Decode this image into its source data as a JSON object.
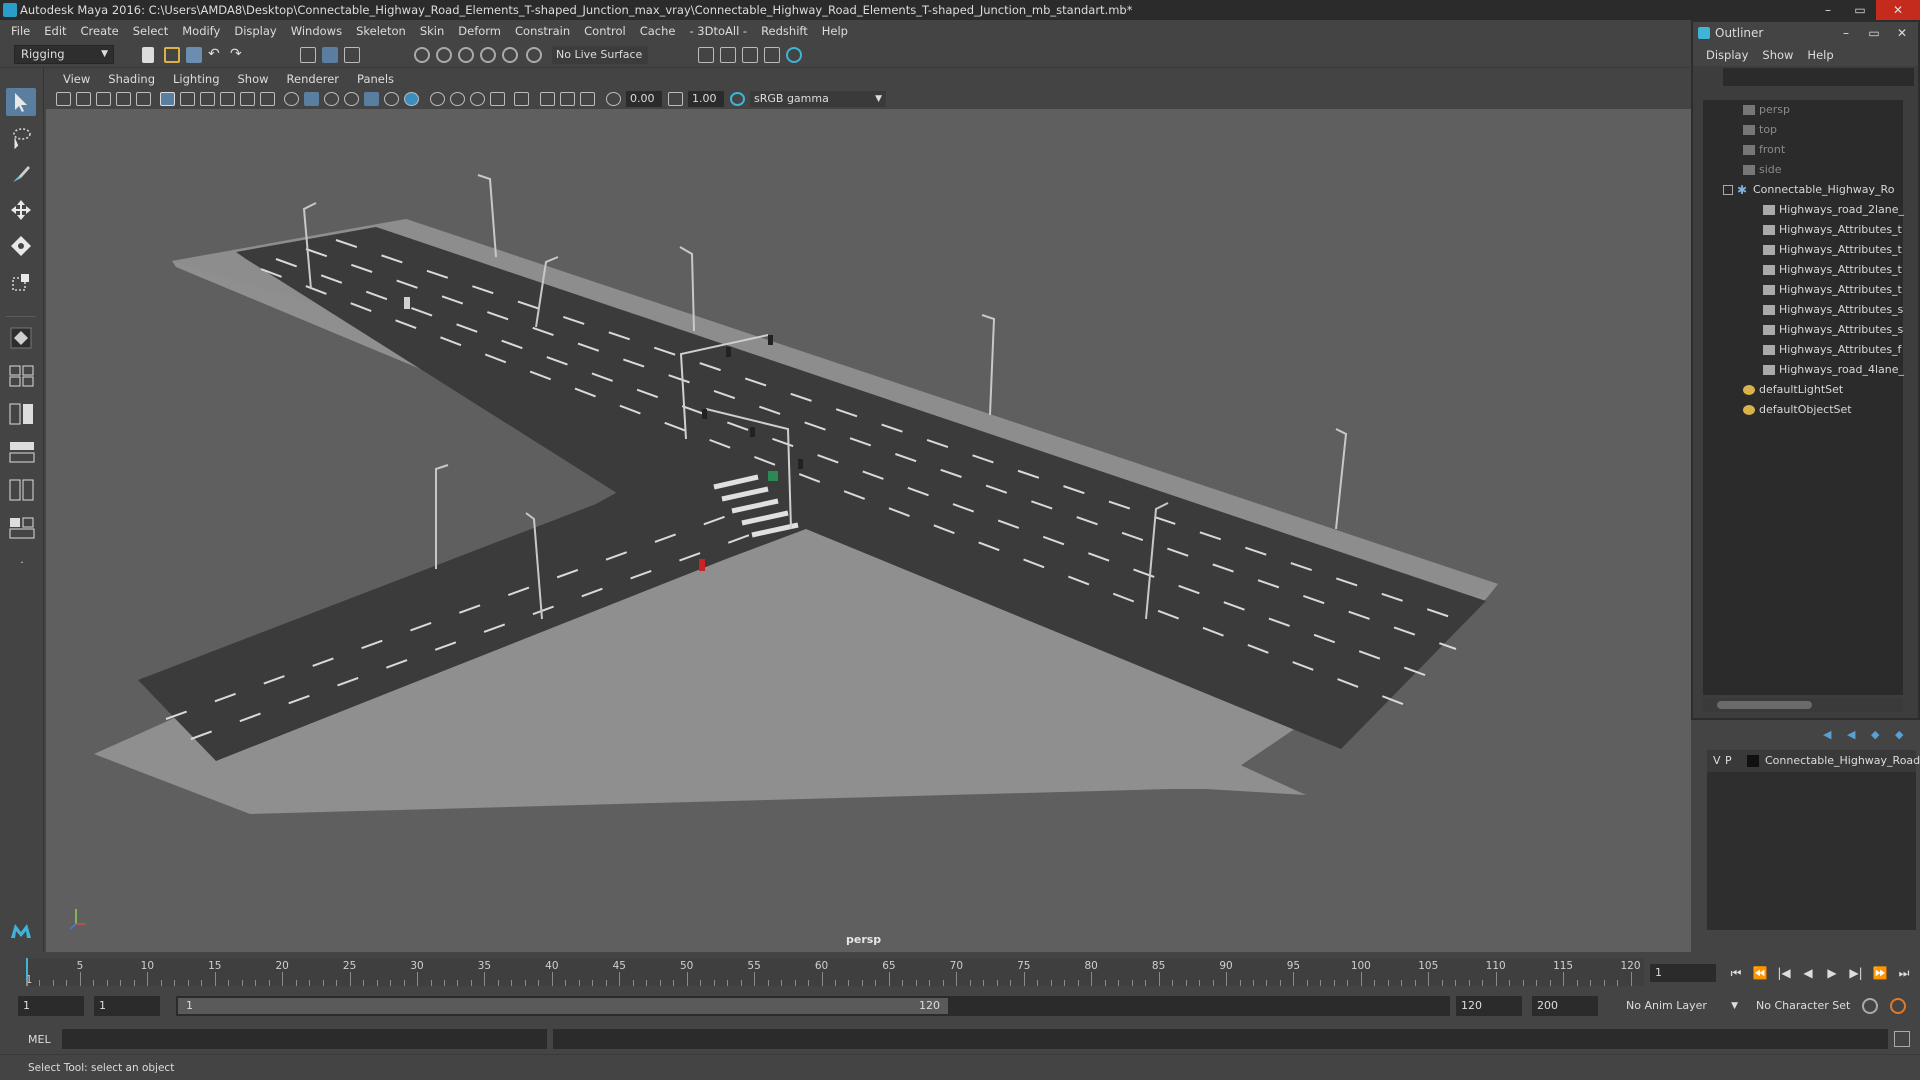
{
  "window": {
    "title": "Autodesk Maya 2016: C:\\Users\\AMDA8\\Desktop\\Connectable_Highway_Road_Elements_T-shaped_Junction_max_vray\\Connectable_Highway_Road_Elements_T-shaped_Junction_mb_standart.mb*",
    "min": "–",
    "max": "▭",
    "close": "✕"
  },
  "menubar": [
    "File",
    "Edit",
    "Create",
    "Select",
    "Modify",
    "Display",
    "Windows",
    "Skeleton",
    "Skin",
    "Deform",
    "Constrain",
    "Control",
    "Cache",
    "- 3DtoAll -",
    "Redshift",
    "Help"
  ],
  "toolbar": {
    "mode": "Rigging",
    "live_surface": "No Live Surface"
  },
  "viewport": {
    "menu": [
      "View",
      "Shading",
      "Lighting",
      "Show",
      "Renderer",
      "Panels"
    ],
    "exposure": "0.00",
    "gamma": "1.00",
    "colorspace": "sRGB gamma",
    "camera_label": "persp"
  },
  "outliner": {
    "title": "Outliner",
    "menu": [
      "Display",
      "Show",
      "Help"
    ],
    "items": [
      {
        "label": "persp",
        "type": "camera",
        "dim": true
      },
      {
        "label": "top",
        "type": "camera",
        "dim": true
      },
      {
        "label": "front",
        "type": "camera",
        "dim": true
      },
      {
        "label": "side",
        "type": "camera",
        "dim": true
      },
      {
        "label": "Connectable_Highway_Ro",
        "type": "group",
        "dim": false
      },
      {
        "label": "Highways_road_2lane_",
        "type": "mesh",
        "dim": false
      },
      {
        "label": "Highways_Attributes_t",
        "type": "mesh",
        "dim": false
      },
      {
        "label": "Highways_Attributes_t",
        "type": "mesh",
        "dim": false
      },
      {
        "label": "Highways_Attributes_t",
        "type": "mesh",
        "dim": false
      },
      {
        "label": "Highways_Attributes_t",
        "type": "mesh",
        "dim": false
      },
      {
        "label": "Highways_Attributes_s",
        "type": "mesh",
        "dim": false
      },
      {
        "label": "Highways_Attributes_s",
        "type": "mesh",
        "dim": false
      },
      {
        "label": "Highways_Attributes_f",
        "type": "mesh",
        "dim": false
      },
      {
        "label": "Highways_road_4lane_",
        "type": "mesh",
        "dim": false
      },
      {
        "label": "defaultLightSet",
        "type": "set",
        "dim": false
      },
      {
        "label": "defaultObjectSet",
        "type": "set",
        "dim": false
      }
    ]
  },
  "layers": {
    "v": "V",
    "p": "P",
    "name": "Connectable_Highway_Road"
  },
  "timeline": {
    "ticks": [
      "5",
      "10",
      "15",
      "20",
      "25",
      "30",
      "35",
      "40",
      "45",
      "50",
      "55",
      "60",
      "65",
      "70",
      "75",
      "80",
      "85",
      "90",
      "95",
      "100",
      "105",
      "110",
      "115",
      "120"
    ],
    "start_tick": "1",
    "current_frame": "1"
  },
  "range": {
    "start": "1",
    "start_inner": "1",
    "slider_start": "1",
    "slider_end": "120",
    "end_inner": "120",
    "end": "200",
    "anim_layer": "No Anim Layer",
    "char_set": "No Character Set"
  },
  "command": {
    "label": "MEL"
  },
  "helpline": "Select Tool: select an object"
}
